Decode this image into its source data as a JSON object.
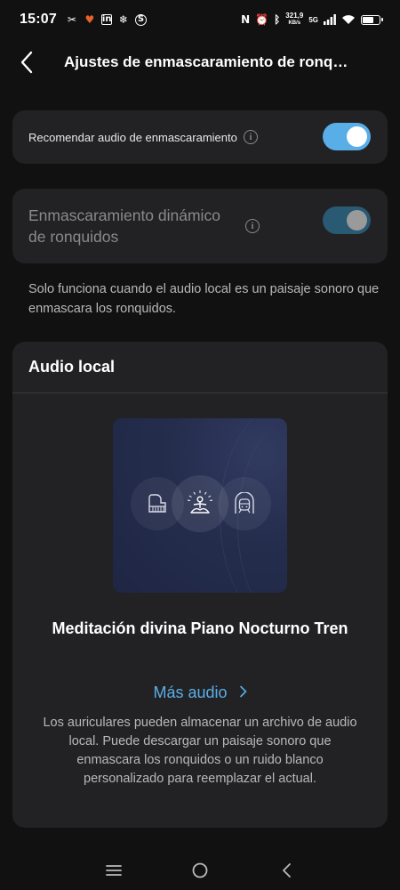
{
  "status_bar": {
    "time": "15:07",
    "left_icons": [
      "capcut-icon",
      "heart-icon",
      "linkedin-icon",
      "snowflake-icon",
      "shazam-icon"
    ],
    "right_icons": [
      "nfc-icon",
      "alarm-icon",
      "bluetooth-icon"
    ],
    "net_speed_value": "321,9",
    "net_speed_unit": "KB/s",
    "network": "5G",
    "battery_level": 0.6
  },
  "header": {
    "title": "Ajustes de enmascaramiento de ronquidos",
    "back_icon": "chevron-left-icon"
  },
  "settings": {
    "recommend_audio": {
      "label": "Recomendar audio de enmascaramiento",
      "enabled": true,
      "toggle_color": "#5aaee8"
    },
    "dynamic_masking": {
      "label": "Enmascaramiento dinámico de ronquidos",
      "enabled": true,
      "disabled": true,
      "toggle_color": "#2a5a73"
    },
    "help_text": "Solo funciona cuando el audio local es un paisaje sonoro que enmascara los ronquidos."
  },
  "local_audio": {
    "title": "Audio local",
    "artwork_icons": [
      "piano-icon",
      "meditation-icon",
      "train-icon"
    ],
    "audio_name": "Meditación divina Piano Nocturno Tren",
    "more_audio_label": "Más audio",
    "description": "Los auriculares pueden almacenar un archivo de audio local. Puede descargar un paisaje sonoro que enmascara los ronquidos o un ruido blanco personalizado para reemplazar el actual."
  },
  "navigation": {
    "buttons": [
      "menu-icon",
      "home-icon",
      "back-icon"
    ]
  },
  "colors": {
    "accent": "#5aaee8",
    "background": "#111111",
    "card": "#222224"
  }
}
